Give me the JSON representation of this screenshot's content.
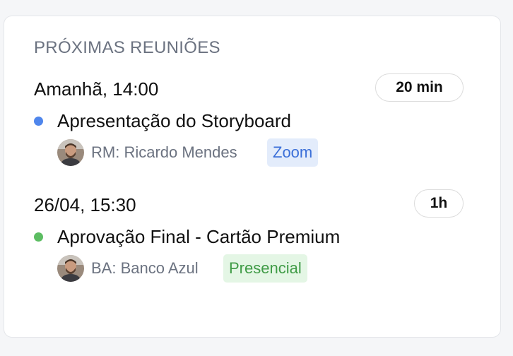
{
  "section": {
    "title": "PRÓXIMAS REUNIÕES"
  },
  "meetings": [
    {
      "when": "Amanhã, 14:00",
      "duration": "20 min",
      "title": "Apresentação do Storyboard",
      "dot_color": "#4f86ec",
      "client": "RM: Ricardo Mendes",
      "tag": "Zoom",
      "tag_text_color": "#3b6fd8",
      "tag_bg_color": "#e3ecfb"
    },
    {
      "when": "26/04, 15:30",
      "duration": "1h",
      "title": "Aprovação Final - Cartão Premium",
      "dot_color": "#5cbd62",
      "client": "BA: Banco Azul",
      "tag": "Presencial",
      "tag_text_color": "#3f9b46",
      "tag_bg_color": "#e4f6e5"
    }
  ],
  "icons": {
    "avatar": "person-avatar-icon"
  }
}
